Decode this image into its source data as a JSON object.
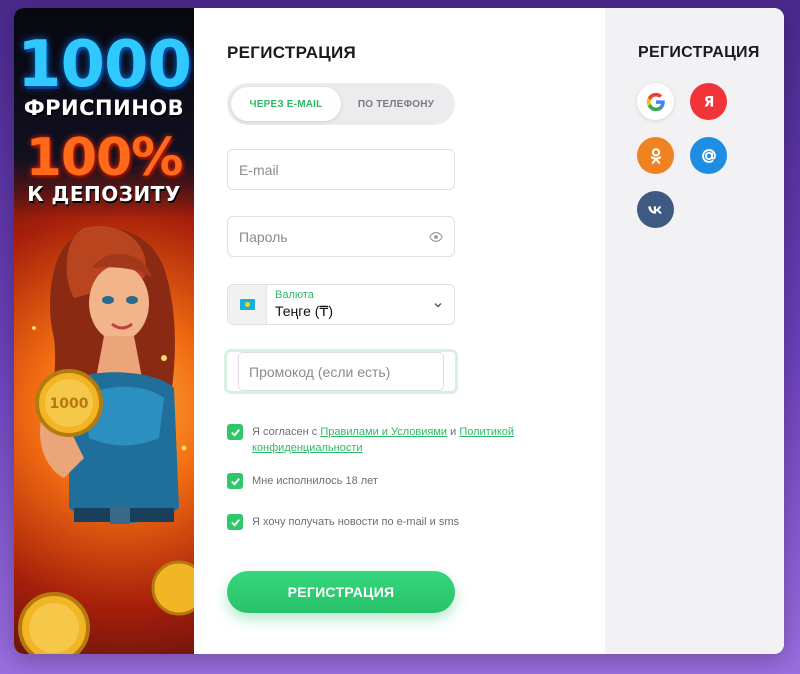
{
  "banner": {
    "line1": "1000",
    "line2": "ФРИСПИНОВ",
    "line3": "100%",
    "line4": "К ДЕПОЗИТУ"
  },
  "form": {
    "title": "РЕГИСТРАЦИЯ",
    "tabs": [
      {
        "label": "ЧЕРЕЗ E-MAIL",
        "active": true
      },
      {
        "label": "ПО ТЕЛЕФОНУ",
        "active": false
      }
    ],
    "email_placeholder": "E-mail",
    "password_placeholder": "Пароль",
    "currency": {
      "label": "Валюта",
      "value": "Теңге (₸)"
    },
    "promo_placeholder": "Промокод (если есть)",
    "checks": {
      "terms_prefix": "Я согласен с ",
      "terms_link": "Правилами и Условиями",
      "terms_and": " и ",
      "privacy_link": "Политикой конфиденциальности",
      "age": "Мне исполнилось 18 лет",
      "news": "Я хочу получать новости по e-mail и sms"
    },
    "submit_label": "РЕГИСТРАЦИЯ"
  },
  "social": {
    "title": "РЕГИСТРАЦИЯ",
    "providers": [
      "google-icon",
      "yandex-icon",
      "odnoklassniki-icon",
      "mail-ru-icon",
      "vk-icon"
    ]
  },
  "colors": {
    "accent": "#2fc869",
    "google_bg": "#ffffff",
    "yandex": "#f0343a",
    "ok": "#f08321",
    "mail": "#1e8de2",
    "vk": "#3f5a82"
  }
}
